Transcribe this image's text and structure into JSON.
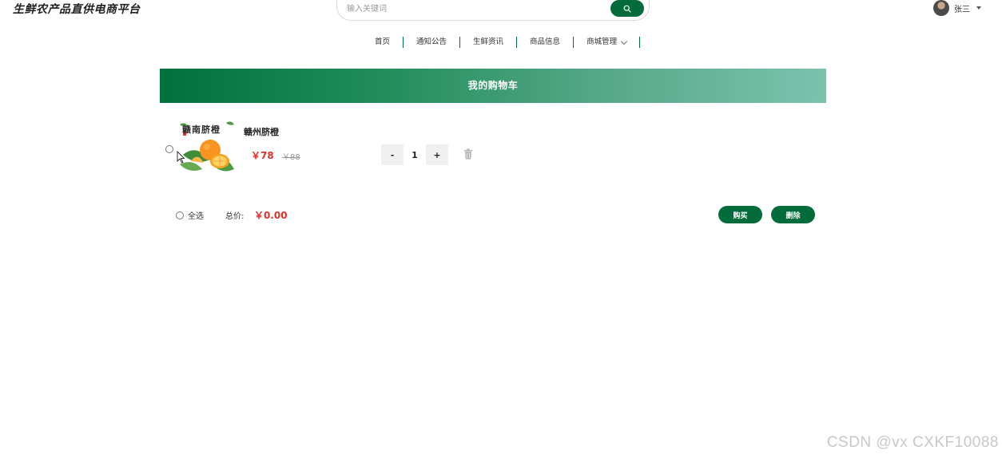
{
  "header": {
    "brand": "生鲜农产品直供电商平台",
    "search": {
      "placeholder": "输入关键词",
      "value": ""
    },
    "user": {
      "name": "张三"
    }
  },
  "nav": {
    "items": [
      {
        "label": "首页"
      },
      {
        "label": "通知公告"
      },
      {
        "label": "生鲜资讯"
      },
      {
        "label": "商品信息"
      },
      {
        "label": "商城管理"
      }
    ]
  },
  "cart": {
    "title": "我的购物车",
    "items": [
      {
        "name": "赣州脐橙",
        "image_text": "赣南脐橙",
        "price": "￥78",
        "original_price": "￥88",
        "quantity": "1",
        "selected": false
      }
    ],
    "footer": {
      "select_all_label": "全选",
      "total_label": "总价:",
      "total_value": "￥0.00",
      "buy_label": "购买",
      "delete_label": "删除"
    }
  },
  "colors": {
    "brand_green": "#046b3b",
    "price_red": "#e0312a"
  },
  "watermark": "CSDN @vx  CXKF10088"
}
